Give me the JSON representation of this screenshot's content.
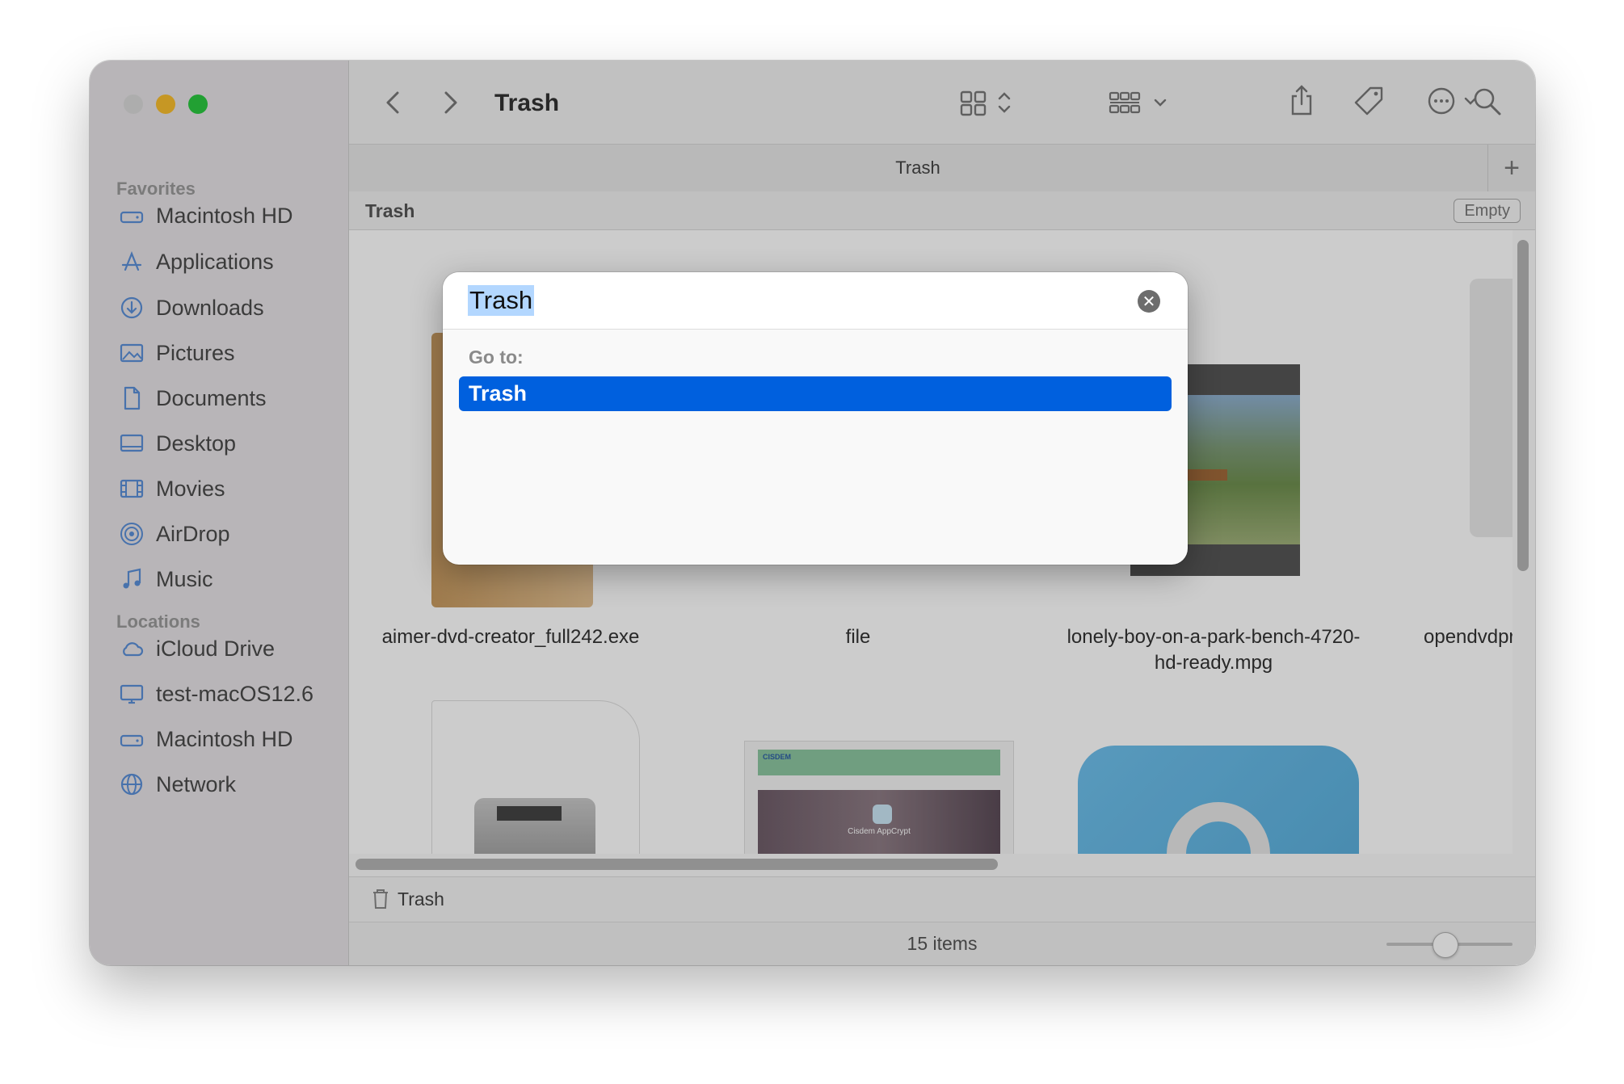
{
  "window": {
    "title": "Trash",
    "tab_label": "Trash",
    "path_title": "Trash",
    "empty_button": "Empty",
    "footer_path": "Trash",
    "status": "15 items"
  },
  "sidebar": {
    "favorites_header": "Favorites",
    "favorites": [
      {
        "label": "Macintosh  HD",
        "icon": "hard-drive-icon"
      },
      {
        "label": "Applications",
        "icon": "applications-icon"
      },
      {
        "label": "Downloads",
        "icon": "downloads-icon"
      },
      {
        "label": "Pictures",
        "icon": "pictures-icon"
      },
      {
        "label": "Documents",
        "icon": "document-icon"
      },
      {
        "label": "Desktop",
        "icon": "desktop-icon"
      },
      {
        "label": "Movies",
        "icon": "movies-icon"
      },
      {
        "label": "AirDrop",
        "icon": "airdrop-icon"
      },
      {
        "label": "Music",
        "icon": "music-icon"
      }
    ],
    "locations_header": "Locations",
    "locations": [
      {
        "label": "iCloud Drive",
        "icon": "cloud-icon"
      },
      {
        "label": "test-macOS12.6",
        "icon": "computer-icon"
      },
      {
        "label": "Macintosh  HD",
        "icon": "hard-drive-icon"
      },
      {
        "label": "Network",
        "icon": "network-icon"
      }
    ]
  },
  "files": [
    {
      "name": "aimer-dvd-creator_full242.exe"
    },
    {
      "name": "file"
    },
    {
      "name": "lonely-boy-on-a-park-bench-4720-",
      "name2": "hd-ready.mpg"
    },
    {
      "name": "opendvdprod"
    }
  ],
  "thumbnail_text": {
    "appcrypt_caption": "Cisdem AppCrypt",
    "brand": "CISDEM"
  },
  "dialog": {
    "input_value": "Trash",
    "goto_label": "Go to:",
    "result": "Trash"
  },
  "colors": {
    "selection": "#0060de",
    "text_selection": "#b3d7ff",
    "minimize": "#f8bd2e",
    "maximize": "#2bc840"
  },
  "zoom_slider_level": 0.47
}
